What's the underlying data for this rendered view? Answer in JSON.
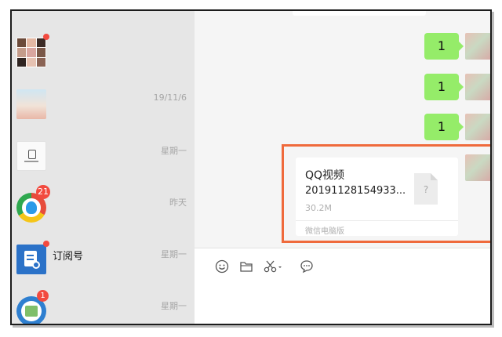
{
  "sidebar": {
    "conversations": [
      {
        "name": "",
        "time": "",
        "badge": "dot",
        "avatar": "group-avatar-grid"
      },
      {
        "name": "",
        "time": "19/11/6",
        "badge": "",
        "avatar": "girl-photo-avatar"
      },
      {
        "name": "",
        "time": "星期一",
        "badge": "",
        "avatar": "logo-avatar"
      },
      {
        "name": "",
        "time": "昨天",
        "badge": "21",
        "avatar": "qq-app-avatar"
      },
      {
        "name": "订阅号",
        "time": "星期一",
        "badge": "dot",
        "avatar": "subscription-icon"
      },
      {
        "name": "",
        "time": "星期一",
        "badge": "1",
        "avatar": "emblem-avatar"
      }
    ]
  },
  "chat": {
    "messages": [
      {
        "text": "1",
        "sender": "self"
      },
      {
        "text": "1",
        "sender": "self"
      },
      {
        "text": "1",
        "sender": "self"
      }
    ],
    "file_message": {
      "name": "QQ视频",
      "name_line2": "20191128154933...",
      "size": "30.2M",
      "source": "微信电脑版",
      "icon_glyph": "?"
    }
  },
  "toolbar": {
    "icons": [
      "emoji-icon",
      "folder-icon",
      "scissors-icon",
      "chat-bubble-icon"
    ],
    "accent": "#95ec69",
    "highlight_color": "#ef6a3c"
  }
}
